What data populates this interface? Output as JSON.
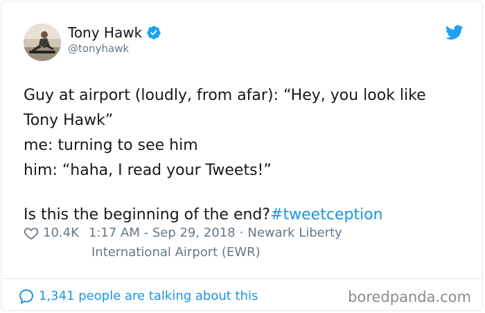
{
  "author": {
    "name": "Tony Hawk",
    "handle": "@tonyhawk",
    "verified": true
  },
  "icons": {
    "verified": "verified-badge-icon",
    "bird": "twitter-bird-icon",
    "heart": "heart-icon",
    "comment": "comment-bubble-icon"
  },
  "colors": {
    "link": "#1b95e0",
    "muted": "#657786",
    "text": "#14171a",
    "border": "#e1e8ed"
  },
  "tweet": {
    "lines": [
      "Guy at airport (loudly, from afar): “Hey, you look like",
      "Tony Hawk”",
      "me: turning to see him",
      "him: “haha, I read your Tweets!”"
    ],
    "last_line_text": "Is this the beginning of the end?",
    "hashtag": "#tweetception"
  },
  "meta": {
    "likes": "10.4K",
    "timestamp": "1:17 AM - Sep 29, 2018",
    "separator": "·",
    "location_part1": "Newark Liberty",
    "location_part2": "International Airport (EWR)"
  },
  "footer": {
    "talking": "1,341 people are talking about this",
    "watermark": "boredpanda.com"
  }
}
